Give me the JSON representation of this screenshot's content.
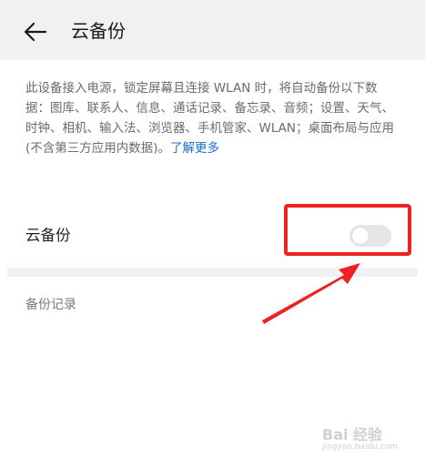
{
  "header": {
    "back_icon": "arrow-left-icon",
    "title": "云备份"
  },
  "description": {
    "text": "此设备接入电源，锁定屏幕且连接 WLAN 时，将自动备份以下数据：图库、联系人、信息、通话记录、备忘录、音频；设置、天气、时钟、相机、输入法、浏览器、手机管家、WLAN；桌面布局与应用 (不含第三方应用内数据)。",
    "link": "了解更多",
    "link_color": "#1a6fd8"
  },
  "cloud_backup": {
    "label": "云备份",
    "enabled": false
  },
  "records": {
    "label": "备份记录"
  },
  "annotation": {
    "color": "#ee2222"
  },
  "watermark": {
    "text": "Bai 经验",
    "sub": "jingyan.baidu.com"
  }
}
